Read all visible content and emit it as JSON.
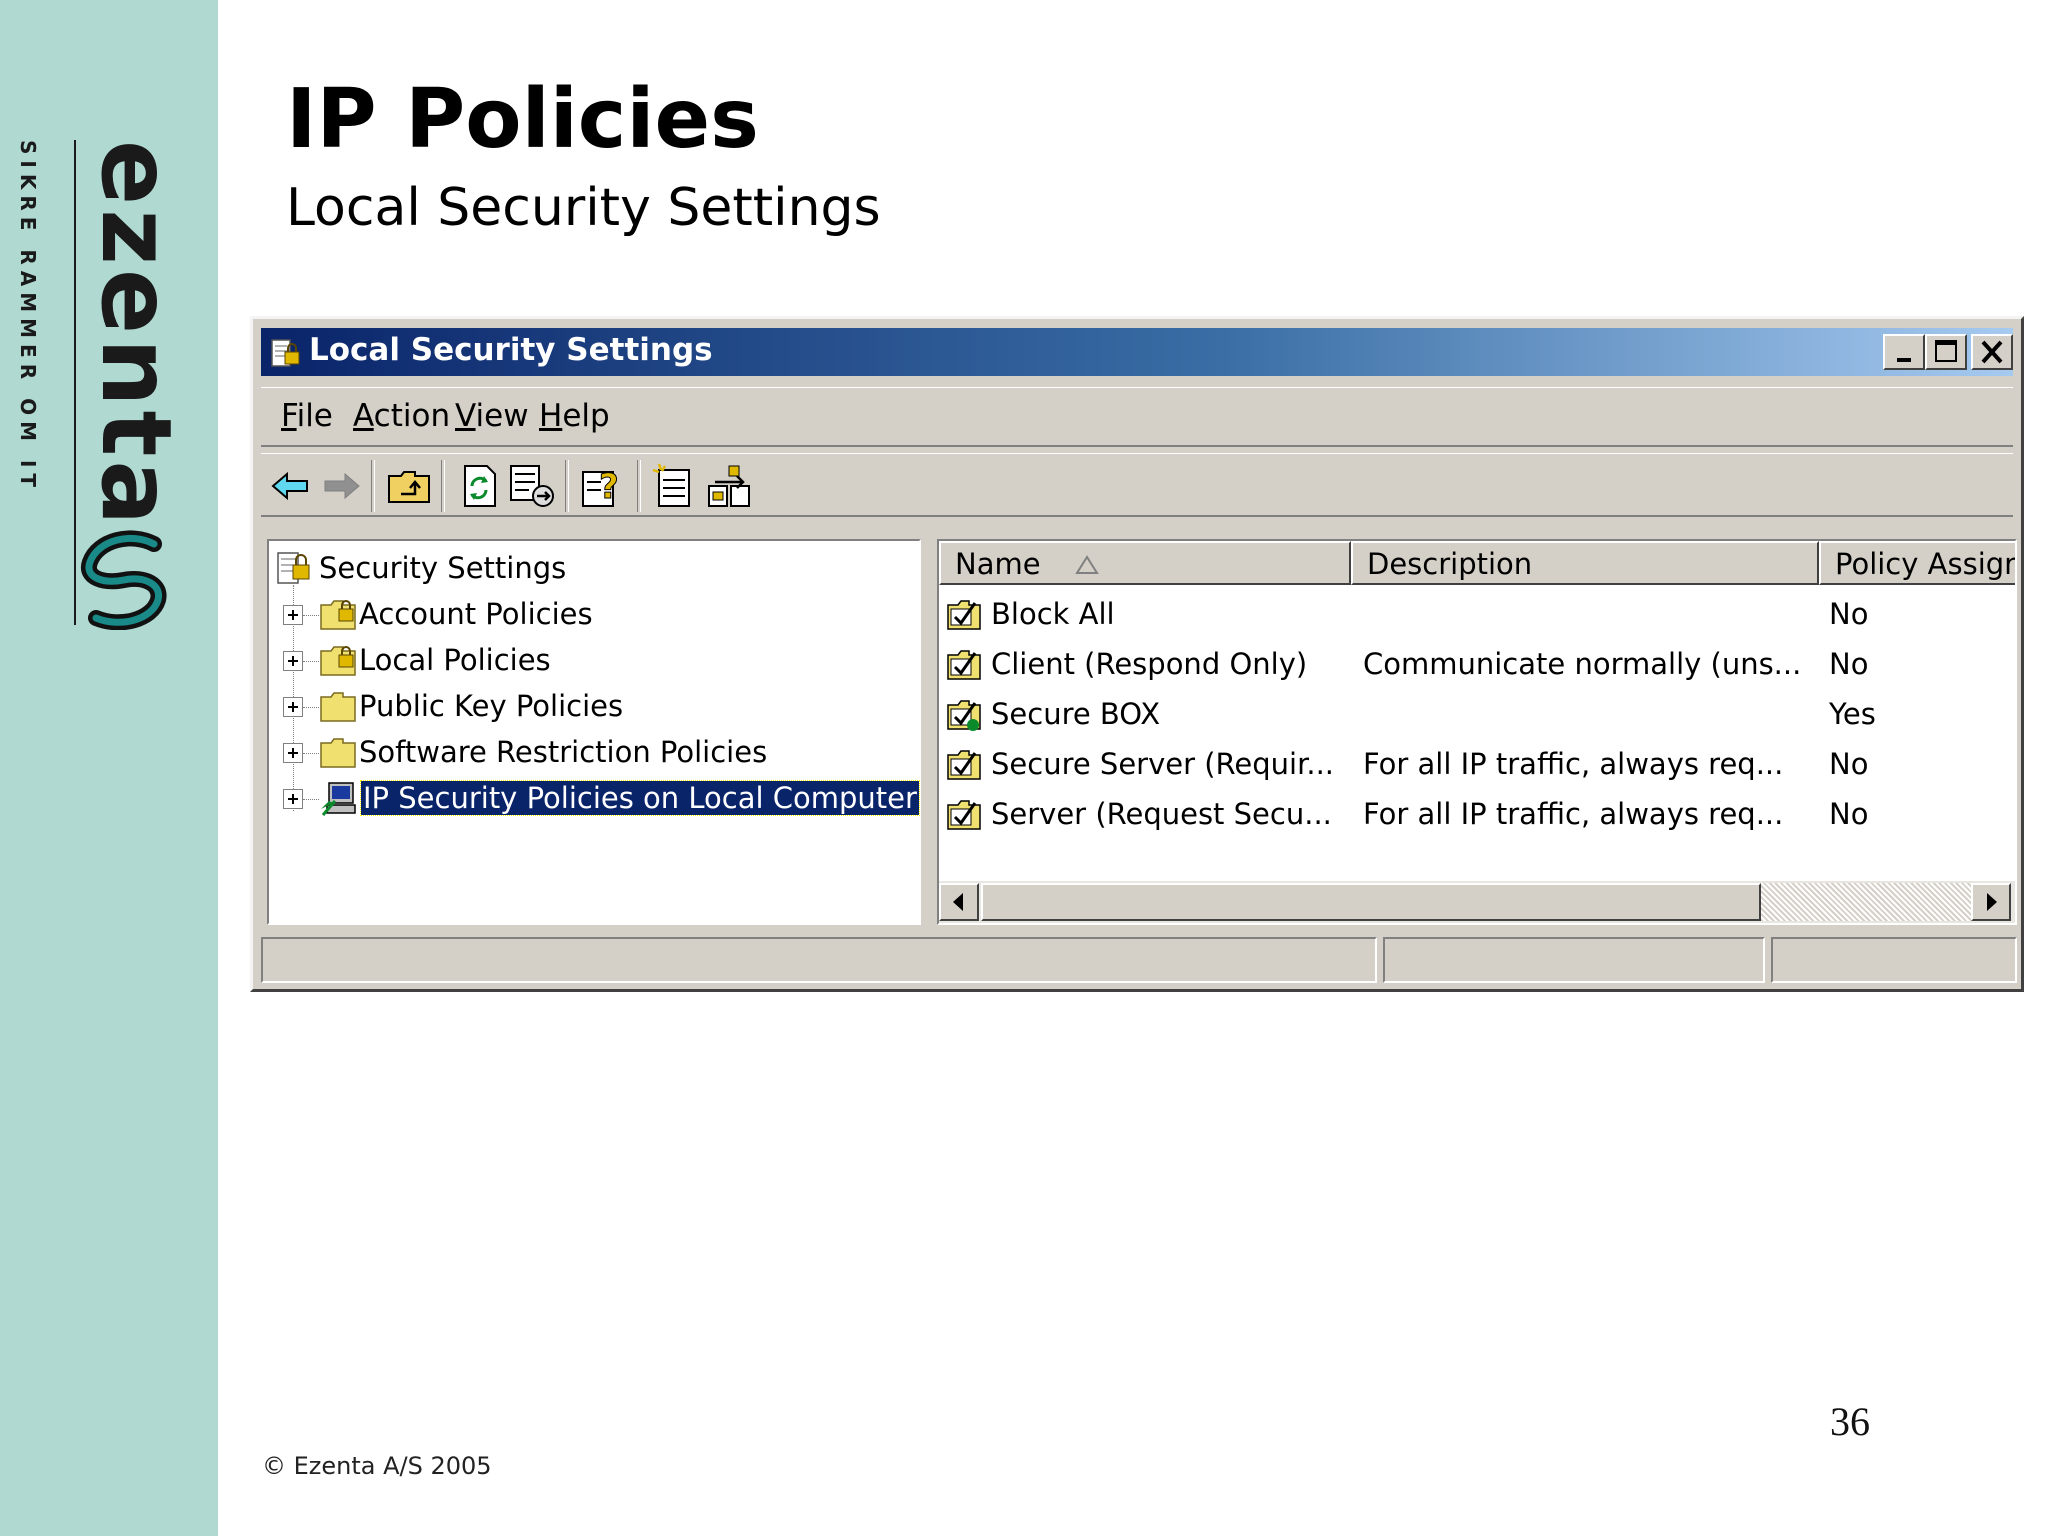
{
  "slide": {
    "title": "IP Policies",
    "subtitle": "Local Security Settings",
    "footer": "© Ezenta A/S 2005",
    "page_number": "36"
  },
  "brand": {
    "logo_text": "ezenta",
    "tagline": "SIKRE RAMMER OM IT",
    "sidebar_color": "#b0d9d2",
    "logo_mark_color": "#1a8a88"
  },
  "window": {
    "title": "Local Security Settings",
    "title_icon": "security-settings-icon",
    "caption_buttons": [
      "minimize-icon",
      "maximize-icon",
      "close-icon"
    ],
    "titlebar_colors": [
      "#0a246a",
      "#a6caf0"
    ],
    "menu": [
      {
        "label": "File",
        "accel": "F",
        "rest": "ile"
      },
      {
        "label": "Action",
        "accel": "A",
        "rest": "ction"
      },
      {
        "label": "View",
        "accel": "V",
        "rest": "iew"
      },
      {
        "label": "Help",
        "accel": "H",
        "rest": "elp"
      }
    ],
    "toolbar": [
      "back-arrow-icon",
      "forward-arrow-icon",
      "up-one-level-icon",
      "refresh-icon",
      "export-list-icon",
      "help-icon",
      "create-ip-policy-icon",
      "manage-filters-icon"
    ],
    "tree": {
      "root": "Security Settings",
      "items": [
        {
          "label": "Account Policies",
          "icon": "locked-folder-icon",
          "selected": false
        },
        {
          "label": "Local Policies",
          "icon": "locked-folder-icon",
          "selected": false
        },
        {
          "label": "Public Key Policies",
          "icon": "folder-icon",
          "selected": false
        },
        {
          "label": "Software Restriction Policies",
          "icon": "folder-icon",
          "selected": false
        },
        {
          "label": "IP Security Policies on Local Computer",
          "icon": "ip-security-computer-icon",
          "selected": true
        }
      ]
    },
    "list": {
      "columns": [
        "Name",
        "Description",
        "Policy Assigne"
      ],
      "sort_icon": "sort-ascending-icon",
      "rows": [
        {
          "name": "Block All",
          "description": "",
          "assigned": "No",
          "icon": "policy-icon"
        },
        {
          "name": "Client (Respond Only)",
          "description": "Communicate normally (uns...",
          "assigned": "No",
          "icon": "policy-icon"
        },
        {
          "name": "Secure BOX",
          "description": "",
          "assigned": "Yes",
          "icon": "assigned-policy-icon"
        },
        {
          "name": "Secure Server (Requir...",
          "description": "For all IP traffic, always req...",
          "assigned": "No",
          "icon": "policy-icon"
        },
        {
          "name": "Server (Request Secu...",
          "description": "For all IP traffic, always req...",
          "assigned": "No",
          "icon": "policy-icon"
        }
      ]
    },
    "selection_color": "#0a246a"
  }
}
